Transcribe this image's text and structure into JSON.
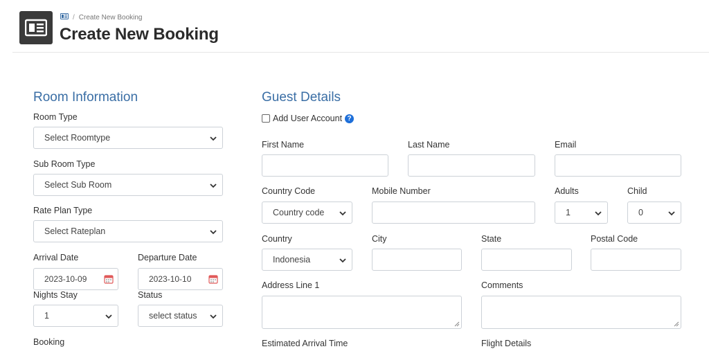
{
  "header": {
    "breadcrumb_current": "Create New Booking",
    "title": "Create New Booking"
  },
  "room": {
    "section_title": "Room Information",
    "room_type_label": "Room Type",
    "room_type_value": "Select Roomtype",
    "sub_room_type_label": "Sub Room Type",
    "sub_room_type_value": "Select Sub Room",
    "rate_plan_label": "Rate Plan Type",
    "rate_plan_value": "Select Rateplan",
    "arrival_label": "Arrival Date",
    "arrival_value": "2023-10-09",
    "departure_label": "Departure Date",
    "departure_value": "2023-10-10",
    "nights_label": "Nights Stay",
    "nights_value": "1",
    "status_label": "Status",
    "status_value": "select status",
    "booking_label": "Booking"
  },
  "guest": {
    "section_title": "Guest Details",
    "add_user_label": "Add User Account",
    "first_name_label": "First Name",
    "last_name_label": "Last Name",
    "email_label": "Email",
    "country_code_label": "Country Code",
    "country_code_value": "Country code",
    "mobile_label": "Mobile Number",
    "adults_label": "Adults",
    "adults_value": "1",
    "child_label": "Child",
    "child_value": "0",
    "country_label": "Country",
    "country_value": "Indonesia",
    "city_label": "City",
    "state_label": "State",
    "postal_label": "Postal Code",
    "address_label": "Address Line 1",
    "comments_label": "Comments",
    "eta_label": "Estimated Arrival Time",
    "flight_label": "Flight Details"
  },
  "colors": {
    "accent": "#3a6ea5",
    "help": "#1e6fd9",
    "calendar": "#e05a5a"
  }
}
